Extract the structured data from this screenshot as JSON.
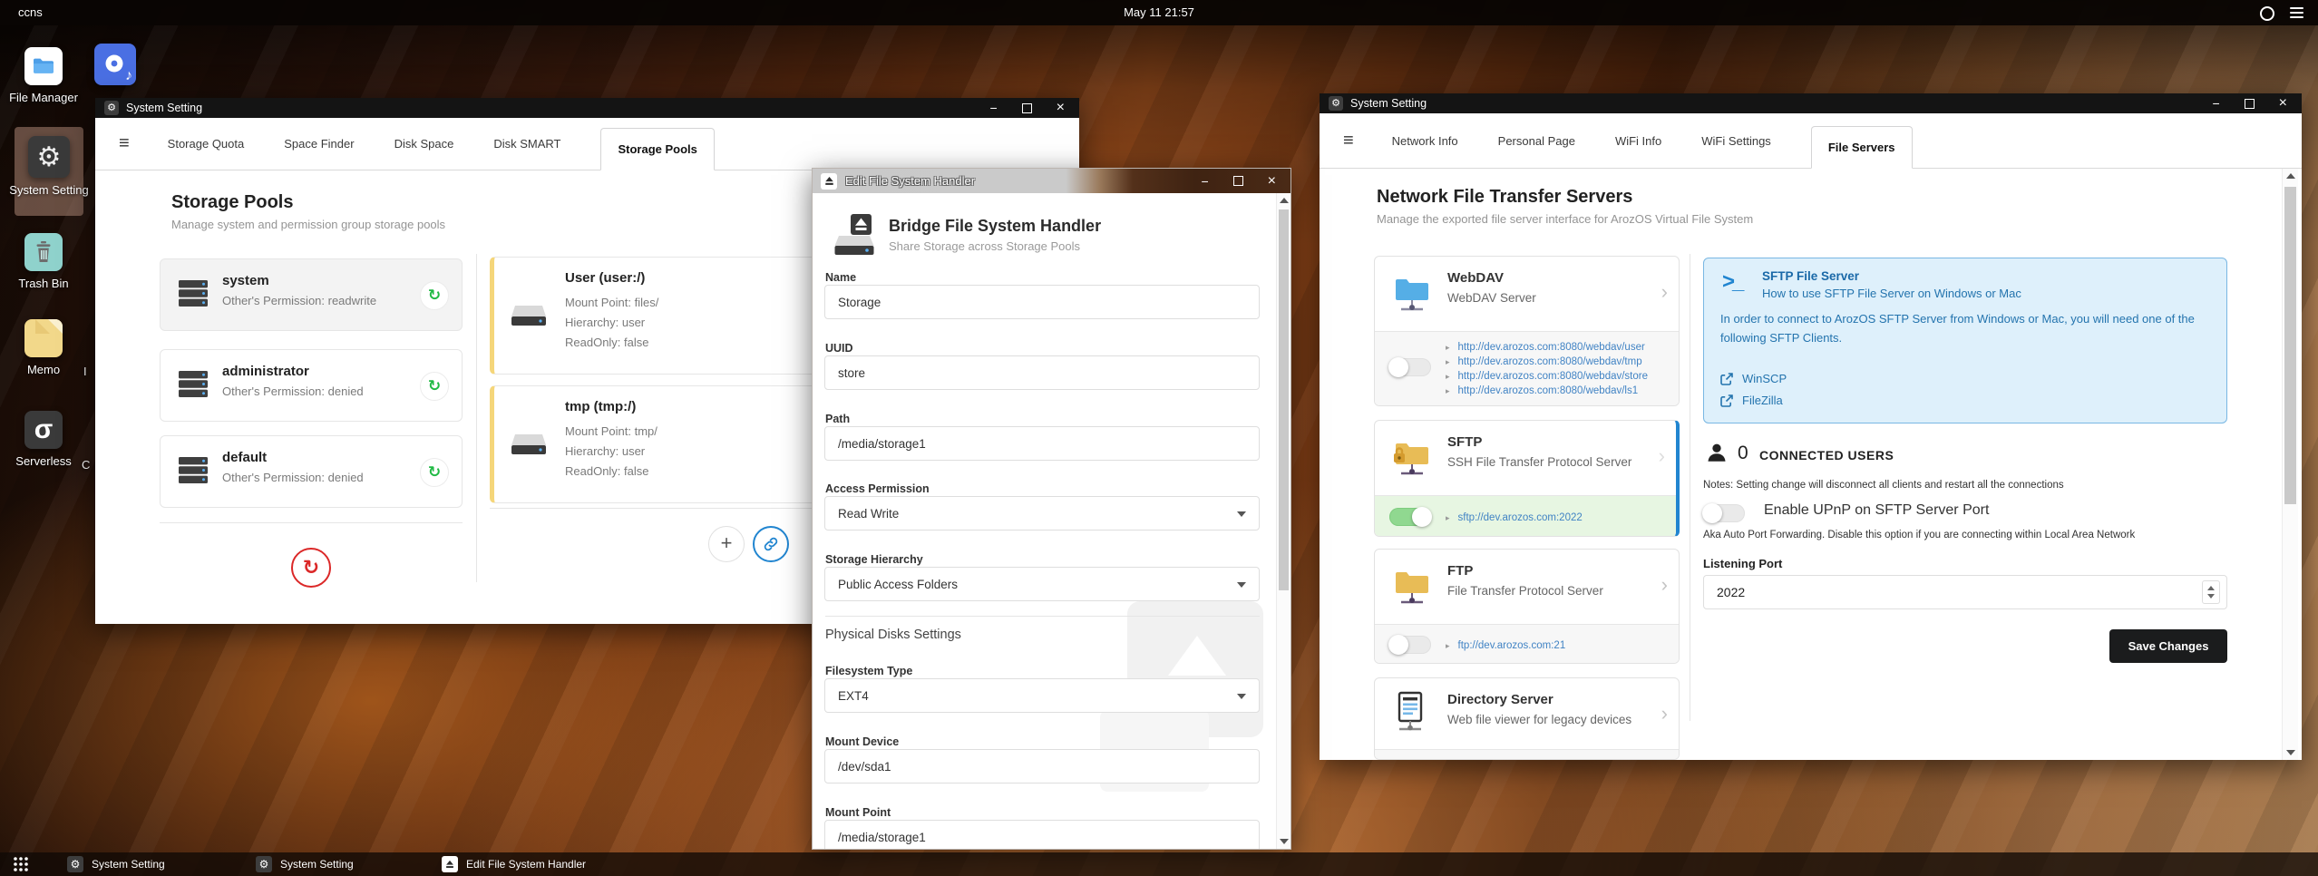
{
  "topbar": {
    "host": "ccns",
    "clock": "May 11 21:57"
  },
  "icons": {
    "gear": "⚙",
    "hamburger": "≡",
    "sync": "↻",
    "chevron": "›",
    "plus": "+",
    "music_note": "♪",
    "sigma": "σ",
    "terminal": ">_",
    "minimize": "−",
    "close": "×",
    "eject": "▲"
  },
  "desktop": {
    "icons": [
      {
        "label": "File Manager"
      },
      {
        "label": "System Setting"
      },
      {
        "label": "Trash Bin"
      },
      {
        "label": "Memo"
      },
      {
        "label": "Serverless"
      }
    ],
    "partial_label_1": "I",
    "partial_label_2": "C"
  },
  "storage_win": {
    "title": "System Setting",
    "tabs": [
      "Storage Quota",
      "Space Finder",
      "Disk Space",
      "Disk SMART",
      "Storage Pools"
    ],
    "heading": "Storage Pools",
    "subheading": "Manage system and permission group storage pools",
    "pools": [
      {
        "name": "system",
        "permission": "Other's Permission: readwrite"
      },
      {
        "name": "administrator",
        "permission": "Other's Permission: denied"
      },
      {
        "name": "default",
        "permission": "Other's Permission: denied"
      }
    ],
    "mounts": [
      {
        "name": "User (user:/)",
        "mount_point": "Mount Point: files/",
        "hierarchy": "Hierarchy: user",
        "readonly": "ReadOnly: false"
      },
      {
        "name": "tmp (tmp:/)",
        "mount_point": "Mount Point: tmp/",
        "hierarchy": "Hierarchy: user",
        "readonly": "ReadOnly: false"
      }
    ]
  },
  "edit": {
    "title": "Edit File System Handler",
    "heading": "Bridge File System Handler",
    "subheading": "Share Storage across Storage Pools",
    "name_label": "Name",
    "name_value": "Storage",
    "uuid_label": "UUID",
    "uuid_value": "store",
    "path_label": "Path",
    "path_value": "/media/storage1",
    "access_label": "Access Permission",
    "access_value": "Read Write",
    "hierarchy_label": "Storage Hierarchy",
    "hierarchy_value": "Public Access Folders",
    "section_label": "Physical Disks Settings",
    "fs_label": "Filesystem Type",
    "fs_value": "EXT4",
    "mount_device_label": "Mount Device",
    "mount_device_value": "/dev/sda1",
    "mount_point_label": "Mount Point",
    "mount_point_value": "/media/storage1"
  },
  "network_win": {
    "title": "System Setting",
    "tabs": [
      "Network Info",
      "Personal Page",
      "WiFi Info",
      "WiFi Settings",
      "File Servers"
    ],
    "heading": "Network File Transfer Servers",
    "subheading": "Manage the exported file server interface for ArozOS Virtual File System",
    "webdav": {
      "name": "WebDAV",
      "desc": "WebDAV Server",
      "links": [
        "http://dev.arozos.com:8080/webdav/user",
        "http://dev.arozos.com:8080/webdav/tmp",
        "http://dev.arozos.com:8080/webdav/store",
        "http://dev.arozos.com:8080/webdav/ls1"
      ]
    },
    "sftp": {
      "name": "SFTP",
      "desc": "SSH File Transfer Protocol Server",
      "link": "sftp://dev.arozos.com:2022"
    },
    "ftp": {
      "name": "FTP",
      "desc": "File Transfer Protocol Server",
      "link": "ftp://dev.arozos.com:21"
    },
    "dirserver": {
      "name": "Directory Server",
      "desc": "Web file viewer for legacy devices"
    },
    "infobox": {
      "title": "SFTP File Server",
      "subtitle": "How to use SFTP File Server on Windows or Mac",
      "body": "In order to connect to ArozOS SFTP Server from Windows or Mac, you will need one of the following SFTP Clients.",
      "client1": "WinSCP",
      "client2": "FileZilla"
    },
    "connected_count": "0",
    "connected_label": "CONNECTED USERS",
    "connected_notes": "Notes: Setting change will disconnect all clients and restart all the connections",
    "upnp_label": "Enable UPnP on SFTP Server Port",
    "upnp_desc": "Aka Auto Port Forwarding. Disable this option if you are connecting within Local Area Network",
    "port_label": "Listening Port",
    "port_value": "2022",
    "save_label": "Save Changes"
  },
  "taskbar": {
    "item1": "System Setting",
    "item2": "System Setting",
    "item3": "Edit File System Handler"
  }
}
